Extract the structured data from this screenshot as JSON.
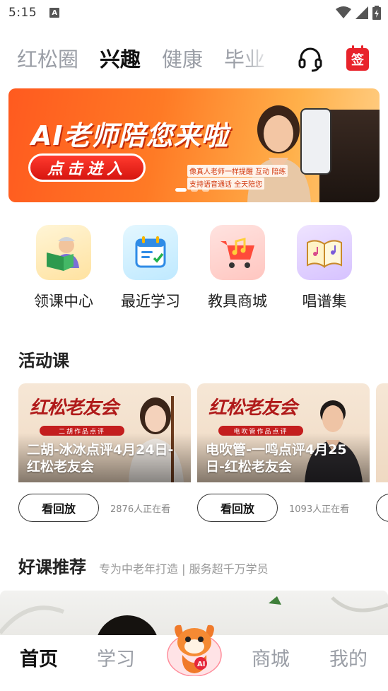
{
  "status": {
    "time": "5:15",
    "notification_icon": "A"
  },
  "top_tabs": [
    {
      "label": "红松圈",
      "active": false
    },
    {
      "label": "兴趣",
      "active": true
    },
    {
      "label": "健康",
      "active": false
    },
    {
      "label": "毕业",
      "active": false
    }
  ],
  "header": {
    "sign_label": "签"
  },
  "banner": {
    "title": "AI老师陪您来啦",
    "button": "点击进入",
    "tag1": "像真人老师一样提醒 互动 陪练",
    "tag2": "支持语音通话 全天陪您",
    "slide_count": 3
  },
  "quick_links": [
    {
      "label": "领课中心",
      "icon": "reading-grandma-icon"
    },
    {
      "label": "最近学习",
      "icon": "calendar-checklist-icon"
    },
    {
      "label": "教具商城",
      "icon": "shopping-cart-music-icon"
    },
    {
      "label": "唱谱集",
      "icon": "music-book-icon"
    }
  ],
  "activity": {
    "title": "活动课",
    "courses": [
      {
        "brand": "红松老友会",
        "ribbon": "二胡作品点评",
        "title": "二胡-冰冰点评4月24日-红松老友会",
        "button": "看回放",
        "watchers": "2876人正在看"
      },
      {
        "brand": "红松老友会",
        "ribbon": "电吹管作品点评",
        "title": "电吹管-一鸣点评4月25日-红松老友会",
        "button": "看回放",
        "watchers": "1093人正在看"
      }
    ]
  },
  "recommend": {
    "title": "好课推荐",
    "subtitle": "专为中老年打造 | 服务超千万学员"
  },
  "bottom_nav": [
    {
      "label": "首页",
      "active": true
    },
    {
      "label": "学习",
      "active": false
    },
    {
      "label": "商城",
      "active": false
    },
    {
      "label": "我的",
      "active": false
    }
  ],
  "colors": {
    "accent": "#ff5a1f",
    "sign": "#e8232b",
    "active_text": "#111111",
    "inactive_text": "#9a9ea6"
  }
}
